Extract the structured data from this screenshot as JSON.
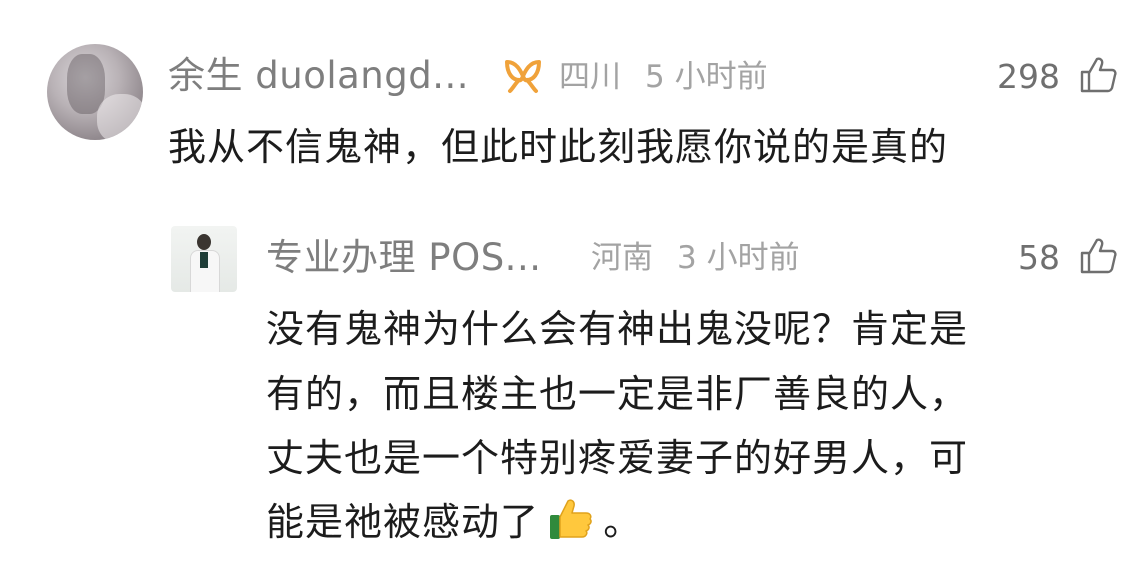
{
  "comment": {
    "username": "余生 duolangd...",
    "badge_icon": "vip-ribbon-icon",
    "badge_color": "#f0a23a",
    "location": "四川",
    "time": "5 小时前",
    "likes": "298",
    "text": "我从不信鬼神，但此时此刻我愿你说的是真的"
  },
  "reply": {
    "username": "专业办理 POS...",
    "location": "河南",
    "time": "3 小时前",
    "likes": "58",
    "lines": [
      "没有鬼神为什么会有神出鬼没呢？肯定是",
      "有的，而且楼主也一定是非厂善良的人，",
      "丈夫也是一个特别疼爱妻子的好男人，可",
      "能是祂被感动了"
    ],
    "emoji_icon": "thumbs-up-emoji",
    "text_end": "。"
  }
}
